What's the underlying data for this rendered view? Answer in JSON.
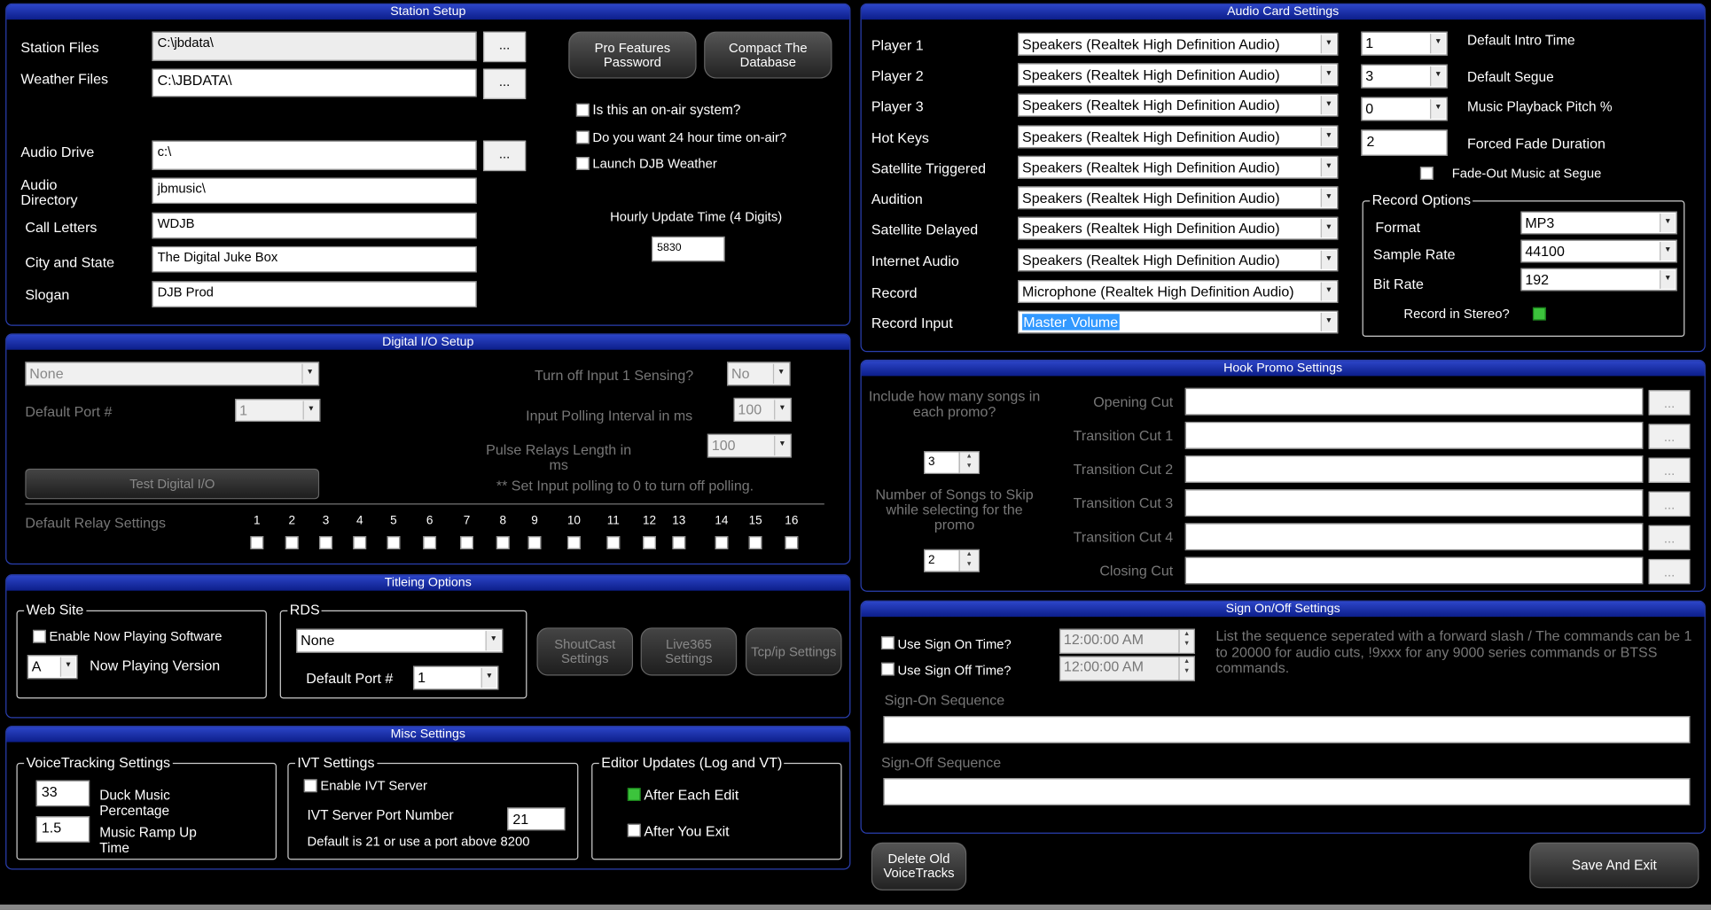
{
  "station": {
    "title": "Station Setup",
    "station_files_label": "Station Files",
    "station_files_value": "C:\\jbdata\\",
    "weather_files_label": "Weather Files",
    "weather_files_value": "C:\\JBDATA\\",
    "audio_drive_label": "Audio Drive",
    "audio_drive_value": "c:\\",
    "audio_dir_label": "Audio Directory",
    "audio_dir_value": "jbmusic\\",
    "call_letters_label": "Call Letters",
    "call_letters_value": "WDJB",
    "city_label": "City and State",
    "city_value": "The Digital Juke Box",
    "slogan_label": "Slogan",
    "slogan_value": "DJB Prod",
    "browse": "...",
    "pro_btn": "Pro Features Password",
    "compact_btn": "Compact The Database",
    "onair_label": "Is this an on-air system?",
    "time24_label": "Do you want 24 hour time on-air?",
    "weather_label": "Launch DJB Weather",
    "hourly_label": "Hourly Update Time (4 Digits)",
    "hourly_value": "5830"
  },
  "digital": {
    "title": "Digital I/O Setup",
    "device_value": "None",
    "port_label": "Default Port #",
    "port_value": "1",
    "input1_label": "Turn off Input 1 Sensing?",
    "input1_value": "No",
    "polling_label": "Input Polling Interval in ms",
    "polling_value": "100",
    "pulse_label": "Pulse Relays Length in ms",
    "pulse_value": "100",
    "test_btn": "Test Digital I/O",
    "note": "**  Set Input polling to 0 to turn off polling.",
    "relay_label": "Default Relay Settings",
    "relays": [
      "1",
      "2",
      "3",
      "4",
      "5",
      "6",
      "7",
      "8",
      "9",
      "10",
      "11",
      "12",
      "13",
      "14",
      "15",
      "16"
    ]
  },
  "titleing": {
    "title": "Titleing Options",
    "website_legend": "Web Site",
    "enable_now_playing": "Enable Now Playing Software",
    "version_value": "A",
    "version_label": "Now Playing Version",
    "rds_legend": "RDS",
    "rds_value": "None",
    "rds_port_label": "Default Port #",
    "rds_port_value": "1",
    "shoutcast_btn": "ShoutCast Settings",
    "live365_btn": "Live365 Settings",
    "tcpip_btn": "Tcp/ip Settings"
  },
  "misc": {
    "title": "Misc Settings",
    "vt_legend": "VoiceTracking Settings",
    "duck_value": "33",
    "duck_label": "Duck Music Percentage",
    "ramp_value": "1.5",
    "ramp_label": "Music Ramp Up Time",
    "ivt_legend": "IVT Settings",
    "enable_ivt": "Enable IVT Server",
    "ivt_port_label": "IVT Server Port Number",
    "ivt_port_value": "21",
    "ivt_note": "Default is 21 or use a port above 8200",
    "editor_legend": "Editor Updates (Log and VT)",
    "after_edit": "After Each Edit",
    "after_exit": "After You Exit"
  },
  "audio": {
    "title": "Audio Card Settings",
    "devices": [
      {
        "label": "Player 1",
        "value": "Speakers (Realtek High Definition Audio)"
      },
      {
        "label": "Player 2",
        "value": "Speakers (Realtek High Definition Audio)"
      },
      {
        "label": "Player 3",
        "value": "Speakers (Realtek High Definition Audio)"
      },
      {
        "label": "Hot Keys",
        "value": "Speakers (Realtek High Definition Audio)"
      },
      {
        "label": "Satellite Triggered",
        "value": "Speakers (Realtek High Definition Audio)"
      },
      {
        "label": "Audition",
        "value": "Speakers (Realtek High Definition Audio)"
      },
      {
        "label": "Satellite Delayed",
        "value": "Speakers (Realtek High Definition Audio)"
      },
      {
        "label": "Internet Audio",
        "value": "Speakers (Realtek High Definition Audio)"
      },
      {
        "label": "Record",
        "value": "Microphone (Realtek High Definition Audio)"
      },
      {
        "label": "Record Input",
        "value": "Master Volume"
      }
    ],
    "intro_value": "1",
    "intro_label": "Default Intro Time",
    "segue_value": "3",
    "segue_label": "Default Segue",
    "pitch_value": "0",
    "pitch_label": "Music Playback Pitch %",
    "fade_value": "2",
    "fade_label": "Forced Fade Duration",
    "fadeout_label": "Fade-Out Music at Segue",
    "record_legend": "Record Options",
    "format_label": "Format",
    "format_value": "MP3",
    "sample_label": "Sample Rate",
    "sample_value": "44100",
    "bitrate_label": "Bit Rate",
    "bitrate_value": "192",
    "stereo_label": "Record in Stereo?"
  },
  "hook": {
    "title": "Hook Promo Settings",
    "include_label": "Include how many songs in each promo?",
    "include_value": "3",
    "skip_label": "Number of Songs to Skip while selecting for the promo",
    "skip_value": "2",
    "cuts": [
      "Opening Cut",
      "Transition Cut 1",
      "Transition Cut 2",
      "Transition Cut 3",
      "Transition Cut 4",
      "Closing Cut"
    ],
    "browse": "..."
  },
  "signon": {
    "title": "Sign On/Off Settings",
    "use_on_label": "Use Sign On Time?",
    "on_time": "12:00:00 AM",
    "use_off_label": "Use Sign Off Time?",
    "off_time": "12:00:00 AM",
    "help": "List the sequence seperated with a forward slash / The commands can be 1 to 20000 for audio cuts, !9xxx for any 9000 series commands or BTSS commands.",
    "on_seq_label": "Sign-On Sequence",
    "off_seq_label": "Sign-Off Sequence"
  },
  "footer": {
    "delete_btn": "Delete Old VoiceTracks",
    "save_btn": "Save And Exit"
  }
}
